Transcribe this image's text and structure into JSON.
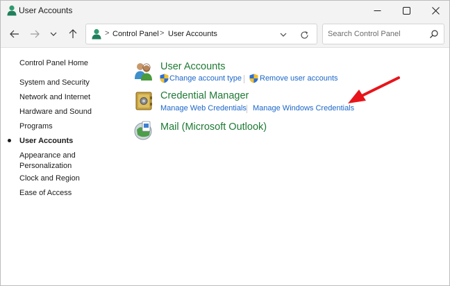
{
  "window": {
    "title": "User Accounts",
    "controls": {
      "minimize": "—",
      "maximize": "☐",
      "close": "✕"
    }
  },
  "nav": {
    "breadcrumb": [
      "Control Panel",
      "User Accounts"
    ],
    "separator": ">",
    "search_placeholder": "Search Control Panel"
  },
  "sidebar": {
    "items": [
      {
        "label": "Control Panel Home",
        "active": false
      },
      {
        "label": "System and Security",
        "active": false
      },
      {
        "label": "Network and Internet",
        "active": false
      },
      {
        "label": "Hardware and Sound",
        "active": false
      },
      {
        "label": "Programs",
        "active": false
      },
      {
        "label": "User Accounts",
        "active": true
      },
      {
        "label": "Appearance and",
        "active": false
      },
      {
        "label": "Personalization",
        "active": false
      },
      {
        "label": "Clock and Region",
        "active": false
      },
      {
        "label": "Ease of Access",
        "active": false
      }
    ]
  },
  "main": {
    "categories": [
      {
        "title": "User Accounts",
        "icon": "users-icon",
        "links": [
          "Change account type",
          "Remove user accounts"
        ]
      },
      {
        "title": "Credential Manager",
        "icon": "vault-icon",
        "links": [
          "Manage Web Credentials",
          "Manage Windows Credentials"
        ]
      },
      {
        "title": "Mail (Microsoft Outlook)",
        "icon": "mail-icon",
        "links": []
      }
    ]
  },
  "colors": {
    "category_title": "#1e7a34",
    "link": "#1b66c9",
    "annotation_arrow": "#e8141b"
  }
}
